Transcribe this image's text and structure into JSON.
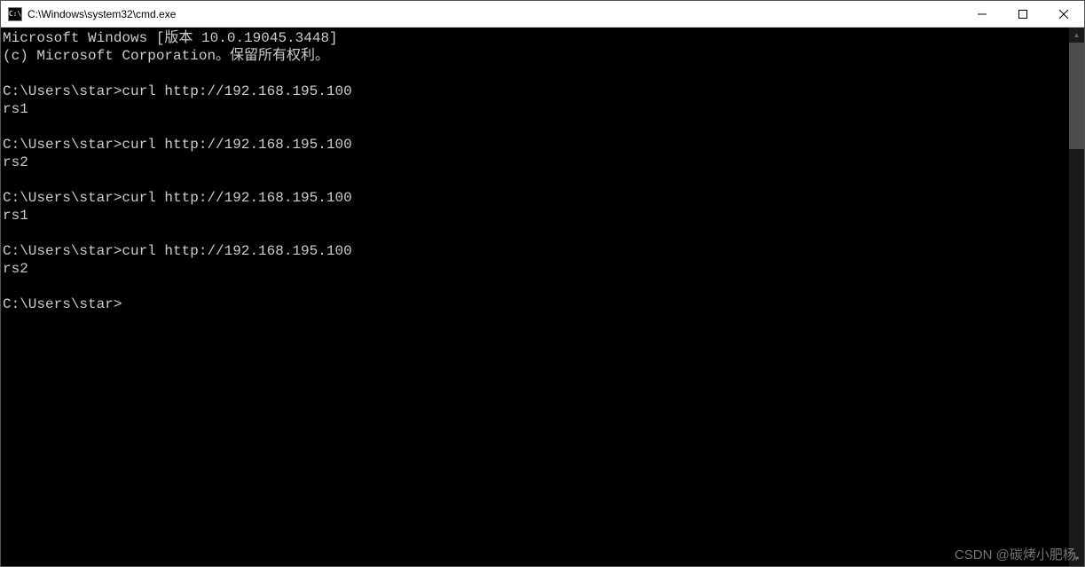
{
  "window": {
    "icon_label": "C:\\",
    "title": "C:\\Windows\\system32\\cmd.exe"
  },
  "terminal": {
    "lines": [
      "Microsoft Windows [版本 10.0.19045.3448]",
      "(c) Microsoft Corporation。保留所有权利。",
      "",
      "C:\\Users\\star>curl http://192.168.195.100",
      "rs1",
      "",
      "C:\\Users\\star>curl http://192.168.195.100",
      "rs2",
      "",
      "C:\\Users\\star>curl http://192.168.195.100",
      "rs1",
      "",
      "C:\\Users\\star>curl http://192.168.195.100",
      "rs2",
      "",
      "C:\\Users\\star>"
    ]
  },
  "watermark": "CSDN @碳烤小肥杨."
}
